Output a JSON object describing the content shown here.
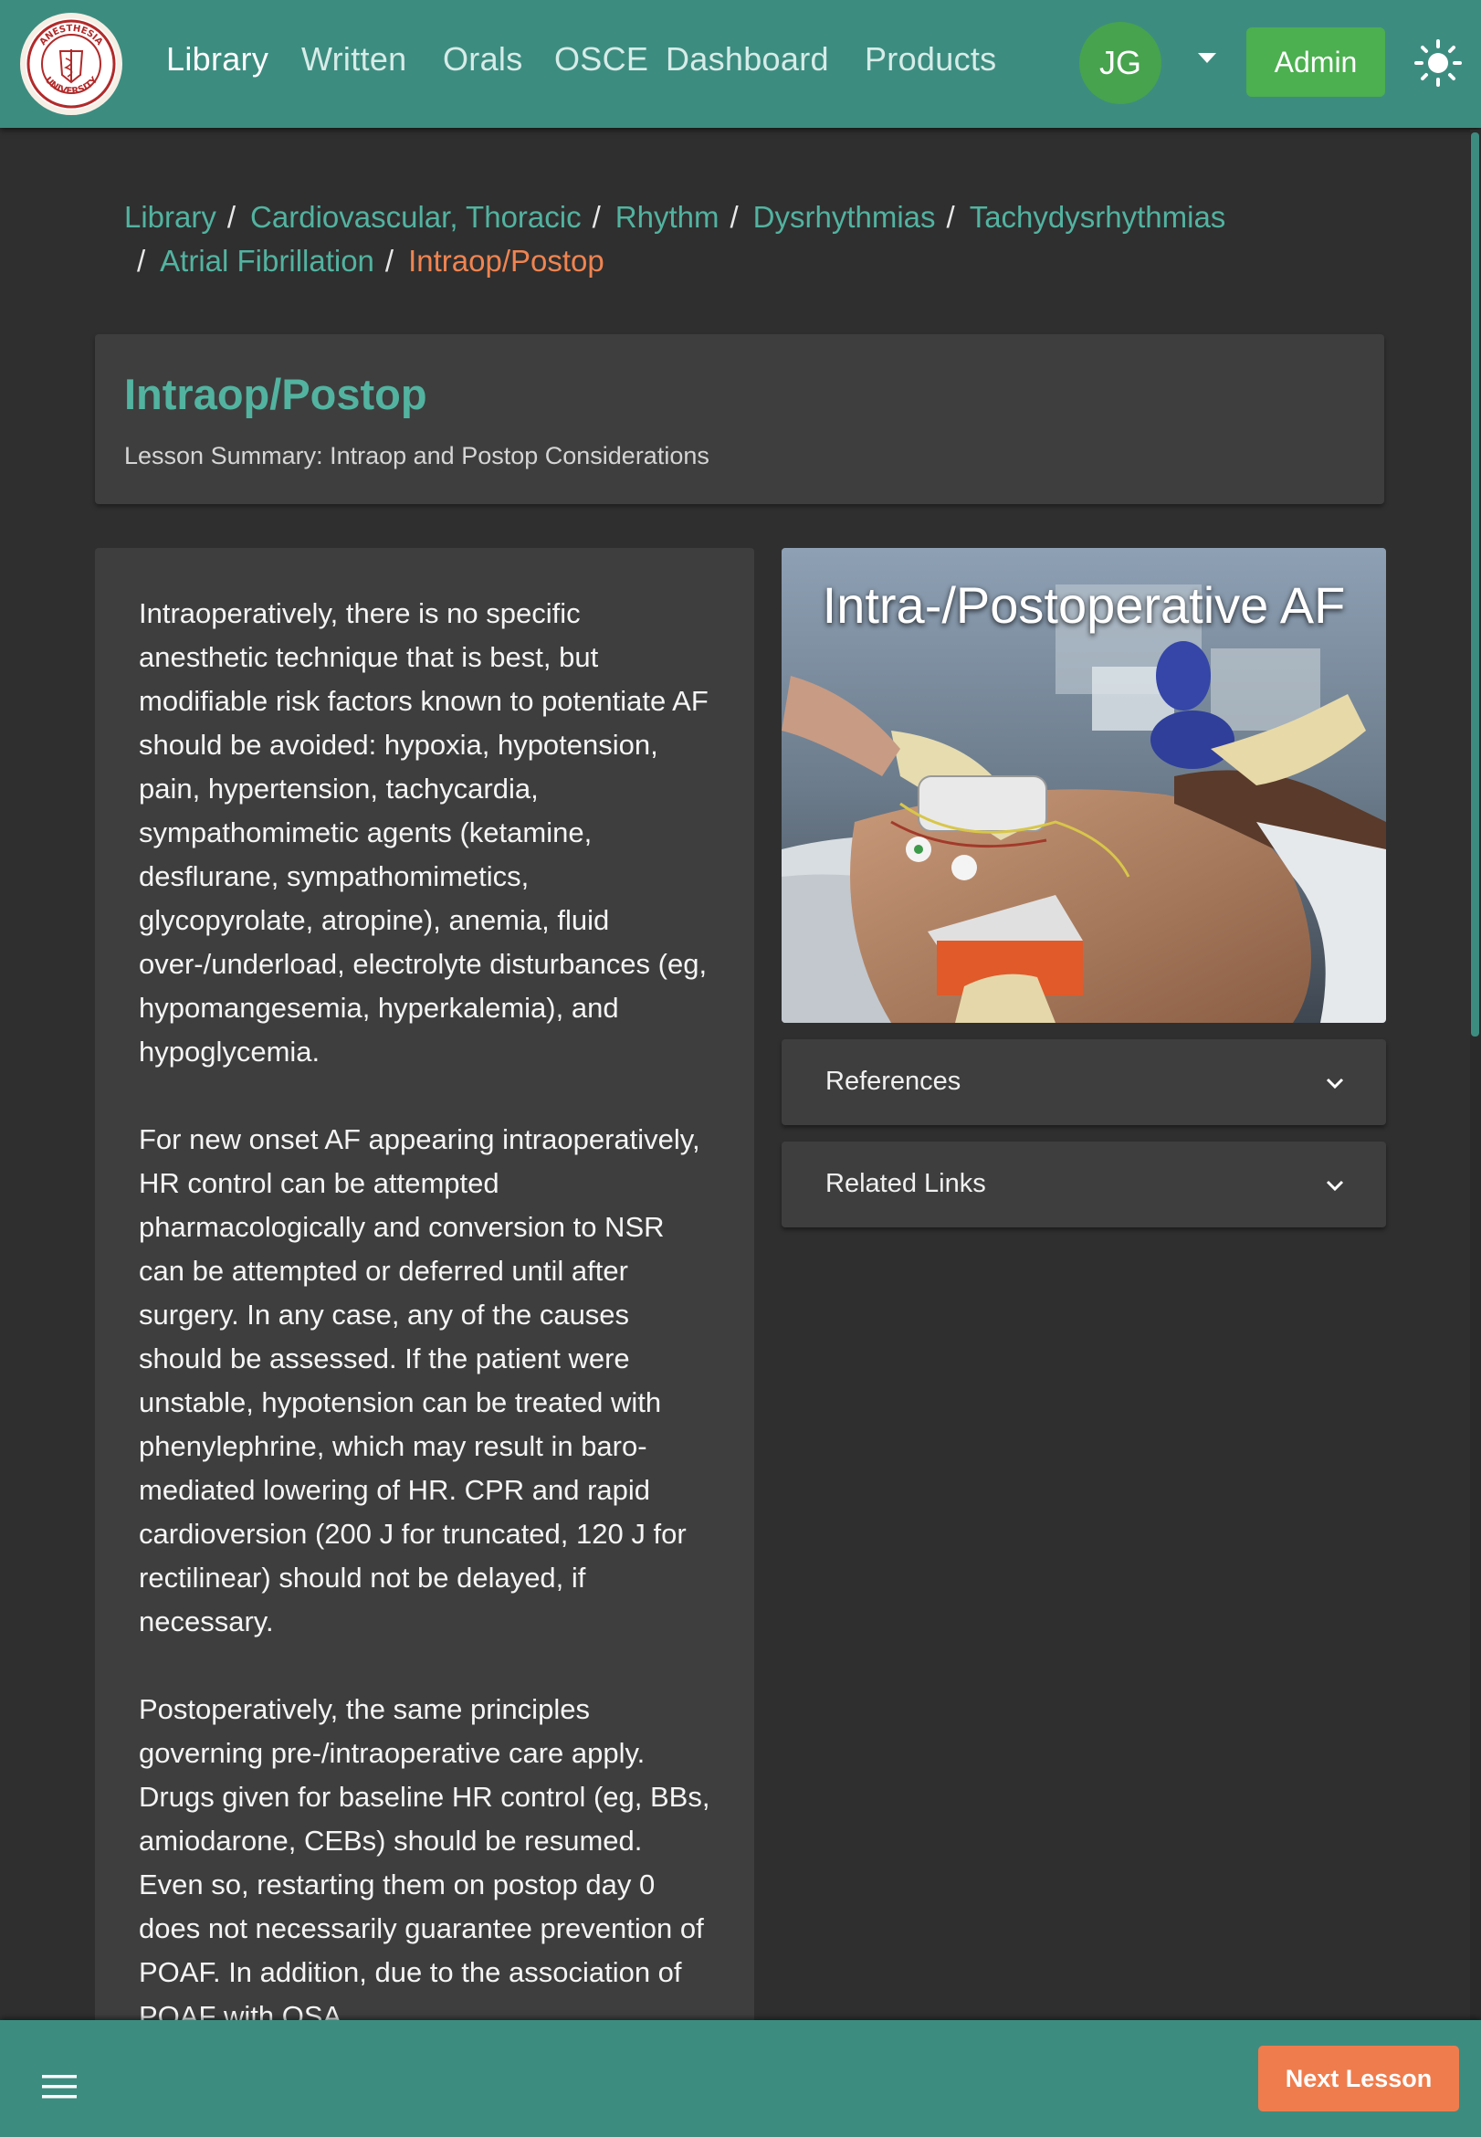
{
  "nav": {
    "logo_text": "ANESTHESIA UNIVERSITY",
    "links": [
      "Library",
      "Written",
      "Orals",
      "OSCE",
      "Dashboard",
      "Products"
    ],
    "active_link": "Library",
    "avatar_initials": "JG",
    "admin_label": "Admin",
    "theme_icon": "sun-icon",
    "colors": {
      "brand": "#3d8c80",
      "avatar": "#47a34d",
      "admin": "#4caf50"
    }
  },
  "breadcrumb": {
    "items": [
      "Library",
      "Cardiovascular, Thoracic",
      "Rhythm",
      "Dysrhythmias",
      "Tachydysrhythmias",
      "Atrial Fibrillation"
    ],
    "current": "Intraop/Postop",
    "separator": "/"
  },
  "lesson": {
    "title": "Intraop/Postop",
    "summary": "Lesson Summary: Intraop and Postop Considerations",
    "paragraphs": [
      "Intraoperatively, there is no specific anesthetic technique that is best, but modifiable risk factors known to potentiate AF should be avoided: hypoxia, hypotension, pain, hypertension, tachycardia, sympathomimetic agents (ketamine, desflurane, sympathomimetics, glycopyrolate, atropine), anemia, fluid over-/underload, electrolyte disturbances (eg, hypomangesemia, hyperkalemia), and hypoglycemia.",
      "For new onset AF appearing intraoperatively, HR control can be attempted pharmacologically and conversion to NSR can be attempted or deferred until after surgery. In any case, any of the causes should be assessed. If the patient were unstable, hypotension can be treated with phenylephrine, which may result in baro-mediated lowering of HR. CPR and rapid cardioversion (200 J for truncated, 120 J for rectilinear) should not be delayed, if necessary.",
      "Postoperatively, the same principles governing pre-/intraoperative care apply. Drugs given for baseline HR control (eg, BBs, amiodarone, CEBs) should be resumed. Even so, restarting them on postop day 0 does not necessarily guarantee prevention of POAF. In addition, due to the association of POAF with OSA"
    ],
    "image_caption": "Intra-/Postoperative AF"
  },
  "accordions": [
    {
      "label": "References",
      "icon": "chevron-down-icon"
    },
    {
      "label": "Related Links",
      "icon": "chevron-down-icon"
    }
  ],
  "footer": {
    "menu_icon": "hamburger-menu-icon",
    "next_label": "Next Lesson",
    "next_color": "#ef7c4d"
  }
}
